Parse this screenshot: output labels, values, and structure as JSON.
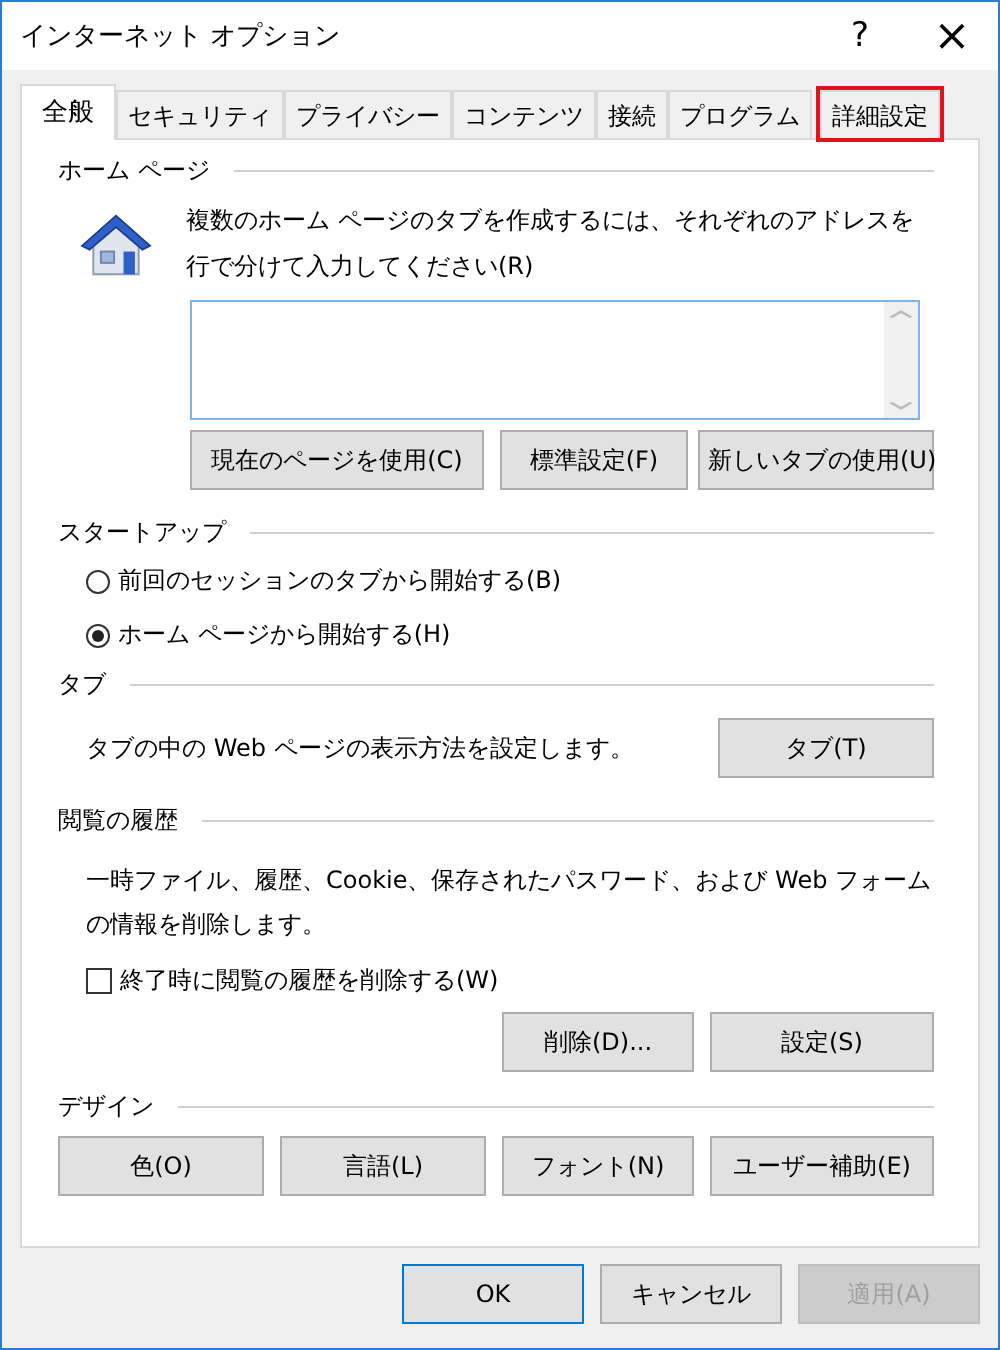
{
  "window": {
    "title": "インターネット オプション",
    "help_button": "?",
    "close_button": "×"
  },
  "tabs": [
    {
      "label": "全般",
      "selected": true,
      "highlighted": false
    },
    {
      "label": "セキュリティ",
      "selected": false,
      "highlighted": false
    },
    {
      "label": "プライバシー",
      "selected": false,
      "highlighted": false
    },
    {
      "label": "コンテンツ",
      "selected": false,
      "highlighted": false
    },
    {
      "label": "接続",
      "selected": false,
      "highlighted": false
    },
    {
      "label": "プログラム",
      "selected": false,
      "highlighted": false
    },
    {
      "label": "詳細設定",
      "selected": false,
      "highlighted": true
    }
  ],
  "home_page": {
    "heading": "ホーム ページ",
    "description": "複数のホーム ページのタブを作成するには、それぞれのアドレスを行で分けて入力してください(R)",
    "buttons": [
      "現在のページを使用(C)",
      "標準設定(F)",
      "新しいタブの使用(U)"
    ]
  },
  "startup": {
    "heading": "スタートアップ",
    "options": [
      {
        "label": "前回のセッションのタブから開始する(B)",
        "selected": false
      },
      {
        "label": "ホーム ページから開始する(H)",
        "selected": true
      }
    ]
  },
  "tab_settings": {
    "heading": "タブ",
    "description": "タブの中の Web ページの表示方法を設定します。",
    "button": "タブ(T)"
  },
  "history": {
    "heading": "閲覧の履歴",
    "description": "一時ファイル、履歴、Cookie、保存されたパスワード、および Web フォームの情報を削除します。",
    "delete_on_exit": {
      "label": "終了時に閲覧の履歴を削除する(W)",
      "checked": false
    },
    "buttons": [
      "削除(D)...",
      "設定(S)"
    ]
  },
  "design": {
    "heading": "デザイン",
    "buttons": [
      "色(O)",
      "言語(L)",
      "フォント(N)",
      "ユーザー補助(E)"
    ]
  },
  "dialog_buttons": [
    {
      "label": "OK",
      "default": true,
      "disabled": false
    },
    {
      "label": "キャンセル",
      "default": false,
      "disabled": false
    },
    {
      "label": "適用(A)",
      "default": false,
      "disabled": true
    }
  ]
}
